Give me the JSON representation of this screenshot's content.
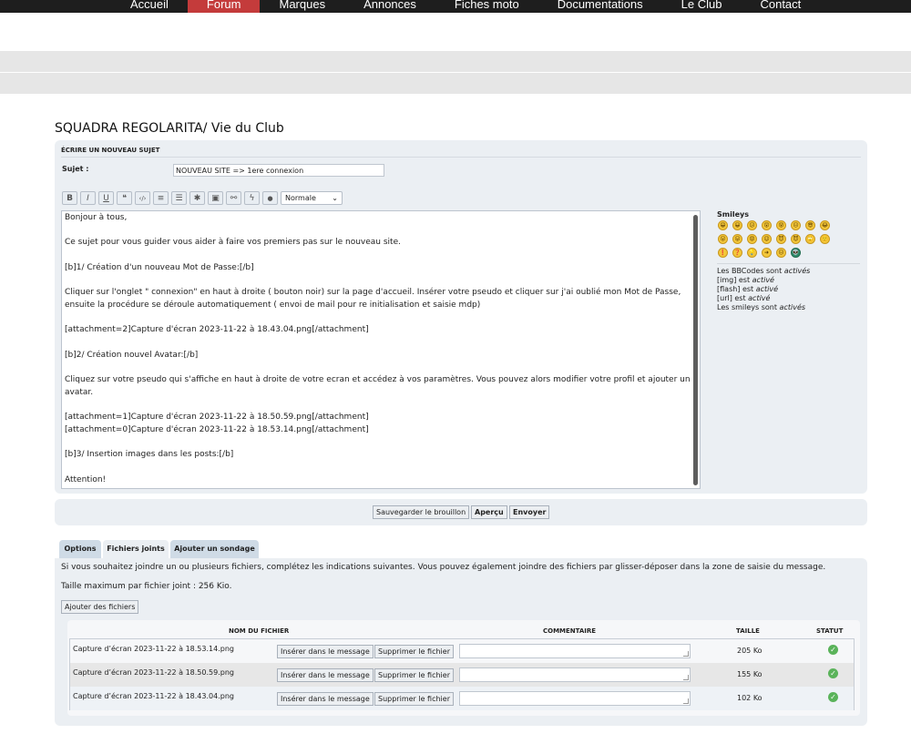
{
  "nav": {
    "items": [
      {
        "label": "Accueil"
      },
      {
        "label": "Forum"
      },
      {
        "label": "Marques"
      },
      {
        "label": "Annonces"
      },
      {
        "label": "Fiches moto"
      },
      {
        "label": "Documentations"
      },
      {
        "label": "Le Club"
      },
      {
        "label": "Contact"
      }
    ],
    "active_color": "#c43b3b"
  },
  "page_title": "SQUADRA REGOLARITA/ Vie du Club",
  "compose": {
    "heading": "Écrire un nouveau sujet",
    "subject_label": "Sujet :",
    "subject_value": "NOUVEAU SITE => 1ere connexion",
    "toolbar": {
      "bold": "B",
      "italic": "I",
      "underline": "U",
      "quote": "❝",
      "code": "‹/›",
      "list": "≡",
      "list_num": "☰",
      "star": "✱",
      "image": "▣",
      "link": "⚯",
      "flash": "ϟ",
      "color": "●",
      "font_size": "Normale"
    },
    "message_lines": [
      "Bonjour à tous,",
      "",
      "Ce sujet pour vous guider vous aider à faire vos premiers pas sur le nouveau site.",
      "",
      "[b]1/ Création d'un nouveau Mot de Passe:[/b]",
      "",
      "Cliquer sur l'onglet \" connexion\" en haut à droite ( bouton noir) sur la page d'accueil. Insérer votre pseudo et cliquer sur j'ai oublié mon Mot de Passe, ensuite la procédure se déroule automatiquement ( envoi de mail pour re initialisation et saisie mdp)",
      "",
      "[attachment=2]Capture d'écran 2023-11-22 à 18.43.04.png[/attachment]",
      "",
      "[b]2/ Création nouvel Avatar:[/b]",
      "",
      "Cliquez sur votre pseudo qui s'affiche en haut à droite de votre ecran et accédez à vos paramètres. Vous pouvez alors modifier votre profil et ajouter un avatar.",
      "",
      "[attachment=1]Capture d'écran 2023-11-22 à 18.50.59.png[/attachment]",
      "[attachment=0]Capture d'écran 2023-11-22 à 18.53.14.png[/attachment]",
      "",
      "[b]3/ Insertion images dans les posts:[/b]",
      "",
      "Attention!"
    ],
    "smileys_title": "Smileys",
    "smileys": [
      "😁",
      "😀",
      "😕",
      "😲",
      "😵",
      "😐",
      "😎",
      "😂",
      "😮",
      "😛",
      "😡",
      "😉",
      "😈",
      "😈",
      "🙄",
      "🙂",
      "❗",
      "❓",
      "💡",
      "➜",
      "😐",
      "👽"
    ],
    "bbcode_info": [
      {
        "pre": "Les BBCodes sont ",
        "em": "activés"
      },
      {
        "pre": "[img] est ",
        "em": "activé"
      },
      {
        "pre": "[flash] est ",
        "em": "activé"
      },
      {
        "pre": "[url] est ",
        "em": "activé"
      },
      {
        "pre": "Les smileys sont ",
        "em": "activés"
      }
    ]
  },
  "actions": {
    "save_draft": "Sauvegarder le brouillon",
    "preview": "Aperçu",
    "send": "Envoyer"
  },
  "tabs": [
    {
      "label": "Options"
    },
    {
      "label": "Fichiers joints"
    },
    {
      "label": "Ajouter un sondage"
    }
  ],
  "attachments": {
    "intro": "Si vous souhaitez joindre un ou plusieurs fichiers, complétez les indications suivantes. Vous pouvez également joindre des fichiers par glisser-déposer dans la zone de saisie du message.",
    "max_size": "Taille maximum par fichier joint : 256 Kio.",
    "add_button": "Ajouter des fichiers",
    "columns": {
      "name": "Nom du fichier",
      "comment": "Commentaire",
      "size": "Taille",
      "status": "Statut"
    },
    "insert_label": "Insérer dans le message",
    "delete_label": "Supprimer le fichier",
    "status_icon": "✓",
    "status_color": "#5ab35a",
    "files": [
      {
        "name": "Capture d’écran 2023-11-22 à 18.53.14.png",
        "size": "205 Ko"
      },
      {
        "name": "Capture d’écran 2023-11-22 à 18.50.59.png",
        "size": "155 Ko"
      },
      {
        "name": "Capture d’écran 2023-11-22 à 18.43.04.png",
        "size": "102 Ko"
      }
    ]
  }
}
